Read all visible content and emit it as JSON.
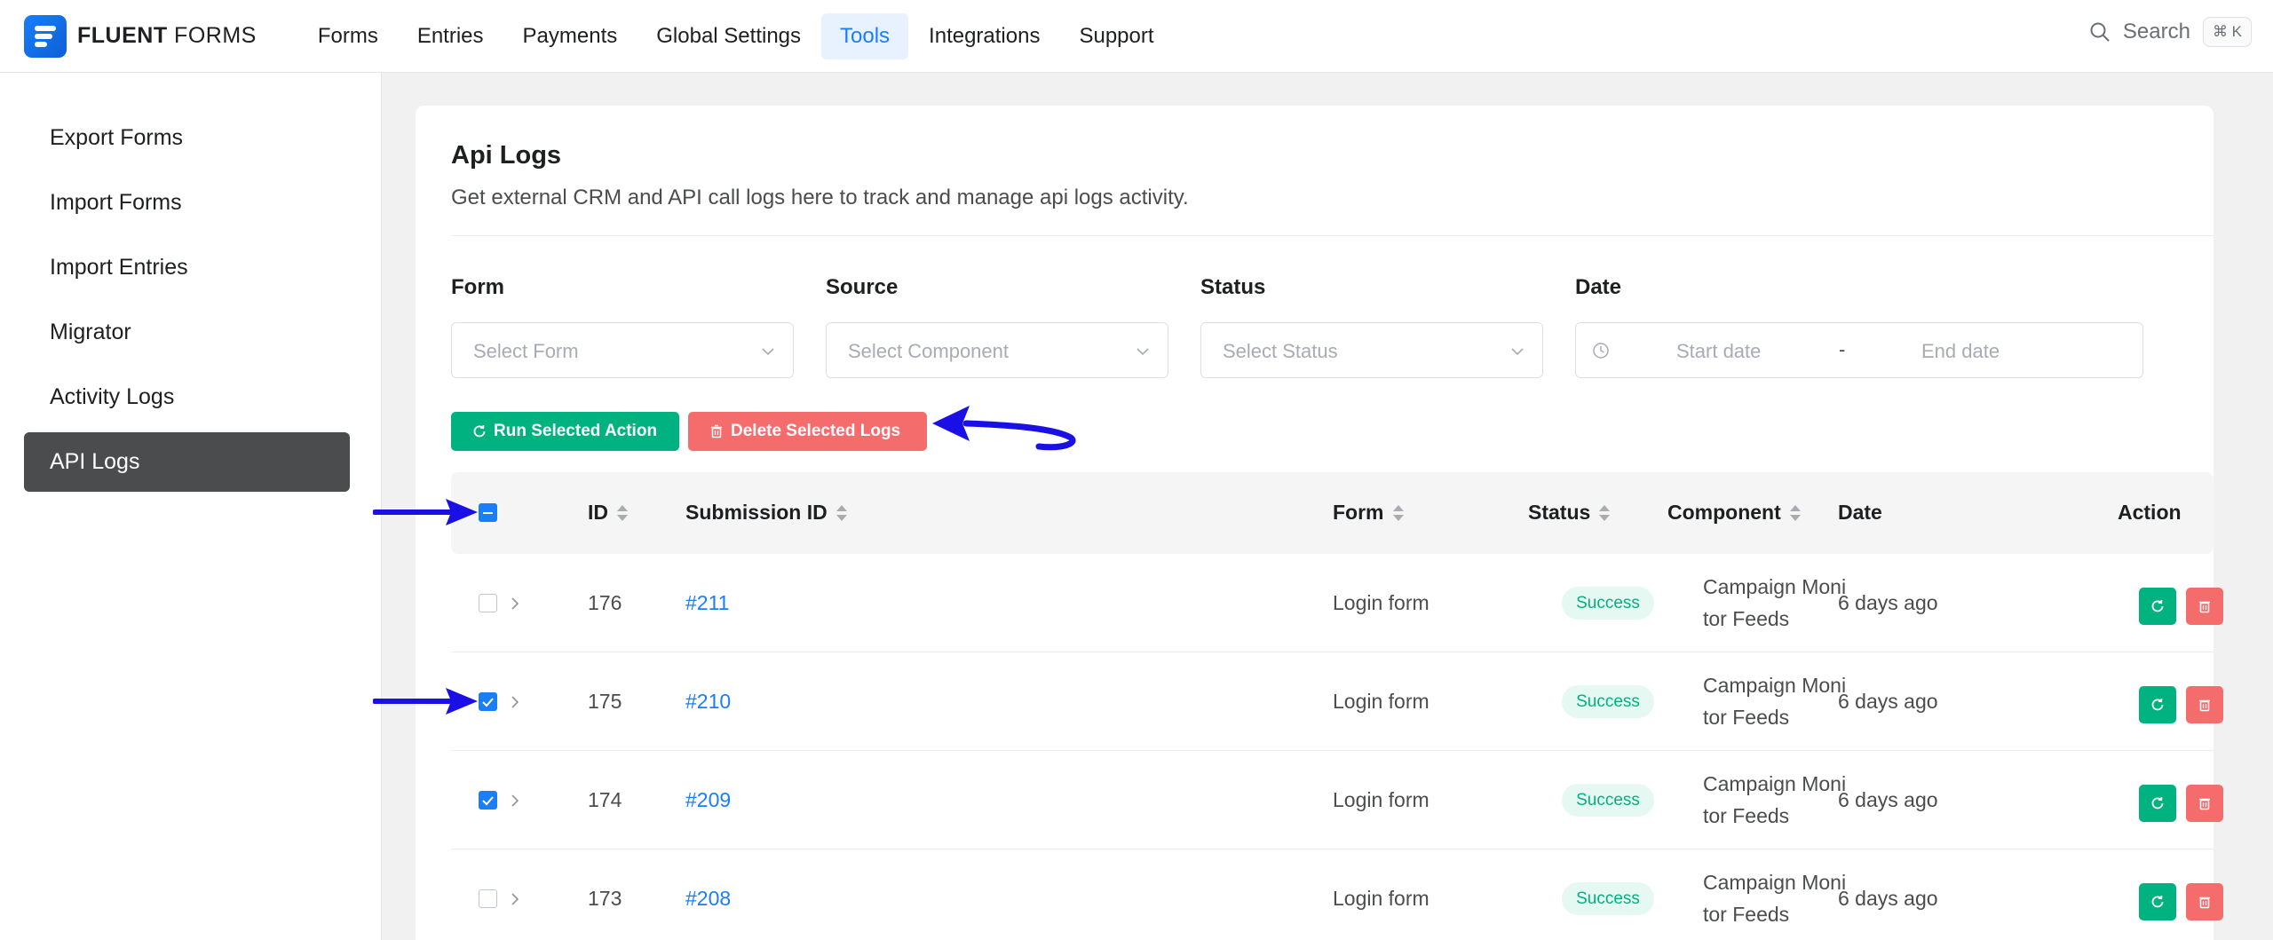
{
  "brand": {
    "name_bold": "FLUENT",
    "name_light": " FORMS"
  },
  "nav": {
    "items": [
      {
        "label": "Forms"
      },
      {
        "label": "Entries"
      },
      {
        "label": "Payments"
      },
      {
        "label": "Global Settings"
      },
      {
        "label": "Tools"
      },
      {
        "label": "Integrations"
      },
      {
        "label": "Support"
      }
    ],
    "active": "Tools"
  },
  "search": {
    "label": "Search",
    "shortcut": "⌘ K"
  },
  "sidebar": {
    "items": [
      {
        "label": "Export Forms"
      },
      {
        "label": "Import Forms"
      },
      {
        "label": "Import Entries"
      },
      {
        "label": "Migrator"
      },
      {
        "label": "Activity Logs"
      },
      {
        "label": "API Logs"
      }
    ],
    "active": "API Logs"
  },
  "page": {
    "title": "Api Logs",
    "subtitle": "Get external CRM and API call logs here to track and manage api logs activity."
  },
  "filters": {
    "form": {
      "label": "Form",
      "placeholder": "Select Form"
    },
    "source": {
      "label": "Source",
      "placeholder": "Select Component"
    },
    "status": {
      "label": "Status",
      "placeholder": "Select Status"
    },
    "date": {
      "label": "Date",
      "start_placeholder": "Start date",
      "separator": "-",
      "end_placeholder": "End date"
    }
  },
  "actions": {
    "run_label": "Run Selected Action",
    "delete_label": "Delete Selected Logs"
  },
  "table": {
    "headers": {
      "id": "ID",
      "submission_id": "Submission ID",
      "form": "Form",
      "status": "Status",
      "component": "Component",
      "date": "Date",
      "action": "Action"
    },
    "rows": [
      {
        "id": "176",
        "submission": "#211",
        "form": "Login form",
        "status": "Success",
        "component_1": "Campaign Moni",
        "component_2": "tor Feeds",
        "date": "6 days ago",
        "checked": false
      },
      {
        "id": "175",
        "submission": "#210",
        "form": "Login form",
        "status": "Success",
        "component_1": "Campaign Moni",
        "component_2": "tor Feeds",
        "date": "6 days ago",
        "checked": true
      },
      {
        "id": "174",
        "submission": "#209",
        "form": "Login form",
        "status": "Success",
        "component_1": "Campaign Moni",
        "component_2": "tor Feeds",
        "date": "6 days ago",
        "checked": true
      },
      {
        "id": "173",
        "submission": "#208",
        "form": "Login form",
        "status": "Success",
        "component_1": "Campaign Moni",
        "component_2": "tor Feeds",
        "date": "6 days ago",
        "checked": false
      }
    ]
  },
  "colors": {
    "primary": "#1a7efb",
    "success": "#00b27f",
    "danger": "#f56c6c",
    "annotation_arrow": "#1a10e6",
    "sidebar_active": "#4b4c4d"
  }
}
